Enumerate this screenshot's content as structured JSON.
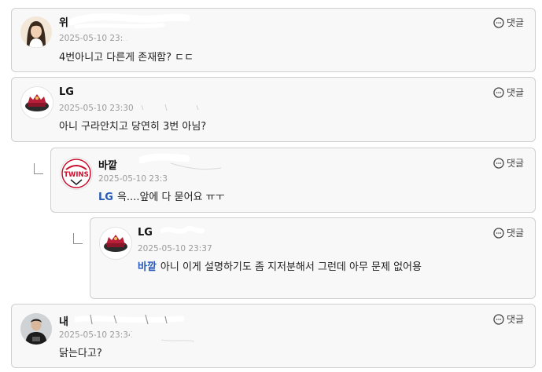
{
  "comments": [
    {
      "nickname": "위",
      "date": "2025-05-10 23:2",
      "text": "4번아니고 다른게 존재함? ㄷㄷ",
      "reply_label": "댓글",
      "avatar": "profile-photo"
    },
    {
      "nickname": "LG",
      "date": "2025-05-10 23:30",
      "text": "아니 구라안치고 당연히 3번 아님?",
      "reply_label": "댓글",
      "avatar": "baseball-emblem"
    },
    {
      "nickname": "바깥",
      "date": "2025-05-10 23:3",
      "mention": "LG",
      "text": "윽....앞에 다 묻어요 ㅠㅜ",
      "reply_label": "댓글",
      "avatar": "twins-logo"
    },
    {
      "nickname": "LG",
      "date": "2025-05-10 23:37",
      "mention": "바깥",
      "text": "아니 이게 설명하기도 좀 지저분해서 그런데 아무 문제 없어용",
      "reply_label": "댓글",
      "avatar": "baseball-emblem"
    },
    {
      "nickname": "내",
      "date": "2025-05-10 23:34",
      "text": "닭는다고?",
      "reply_label": "댓글",
      "avatar": "profile-photo"
    }
  ],
  "colors": {
    "card_bg": "#f8f8f8",
    "border": "#cfcfcf",
    "mention": "#2a5ab8",
    "twins_red": "#c8102e"
  },
  "icons": {
    "reply": "speech-bubble-icon",
    "thread": "reply-elbow-icon"
  }
}
